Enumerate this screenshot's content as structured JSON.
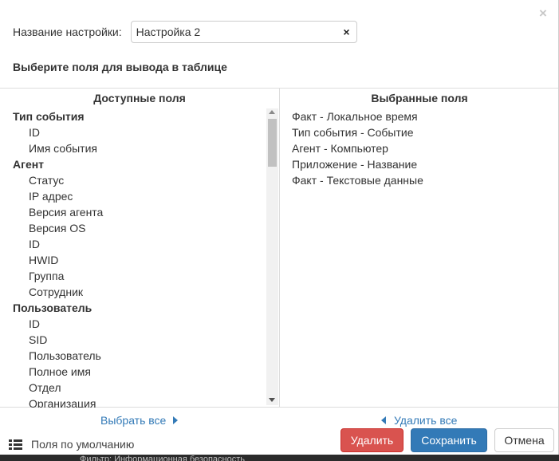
{
  "dialog": {
    "name_label": "Название настройки:",
    "name_value": "Настройка 2",
    "clear_symbol": "×",
    "close_symbol": "×",
    "section_title": "Выберите поля для вывода в таблице"
  },
  "available": {
    "header": "Доступные поля",
    "rows": [
      {
        "type": "group",
        "label": "Тип события"
      },
      {
        "type": "field",
        "label": "ID"
      },
      {
        "type": "field",
        "label": "Имя события"
      },
      {
        "type": "group",
        "label": "Агент"
      },
      {
        "type": "field",
        "label": "Статус"
      },
      {
        "type": "field",
        "label": "IP адрес"
      },
      {
        "type": "field",
        "label": "Версия агента"
      },
      {
        "type": "field",
        "label": "Версия OS"
      },
      {
        "type": "field",
        "label": "ID"
      },
      {
        "type": "field",
        "label": "HWID"
      },
      {
        "type": "field",
        "label": "Группа"
      },
      {
        "type": "field",
        "label": "Сотрудник"
      },
      {
        "type": "group",
        "label": "Пользователь"
      },
      {
        "type": "field",
        "label": "ID"
      },
      {
        "type": "field",
        "label": "SID"
      },
      {
        "type": "field",
        "label": "Пользователь"
      },
      {
        "type": "field",
        "label": "Полное имя"
      },
      {
        "type": "field",
        "label": "Отдел"
      },
      {
        "type": "field",
        "label": "Организация"
      }
    ]
  },
  "selected": {
    "header": "Выбранные поля",
    "rows": [
      "Факт - Локальное время",
      "Тип события - Событие",
      "Агент - Компьютер",
      "Приложение - Название",
      "Факт - Текстовые данные"
    ]
  },
  "actions": {
    "select_all": "Выбрать все",
    "remove_all": "Удалить все",
    "defaults": "Поля по умолчанию"
  },
  "buttons": {
    "delete": "Удалить",
    "save": "Сохранить",
    "cancel": "Отмена"
  },
  "background_text": "Фильтр: Информационная безопасность",
  "colors": {
    "primary": "#337ab7",
    "danger": "#d9534f",
    "link": "#337ab7"
  }
}
